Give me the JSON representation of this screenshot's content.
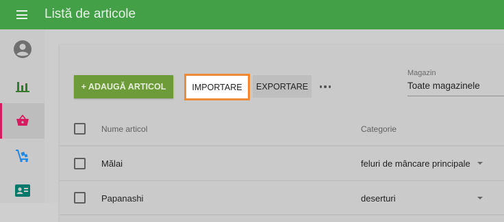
{
  "header": {
    "title": "Listă de articole",
    "bar_color": "#43a047"
  },
  "sidebar": {
    "items": [
      {
        "icon": "account-circle-icon",
        "active": false
      },
      {
        "icon": "bar-chart-icon",
        "active": false
      },
      {
        "icon": "basket-icon",
        "active": true
      },
      {
        "icon": "inventory-cart-icon",
        "active": false
      },
      {
        "icon": "contact-card-icon",
        "active": false
      }
    ],
    "active_indicator_color": "#d81b60"
  },
  "toolbar": {
    "add_label": "+ ADAUGĂ ARTICOL",
    "import_label": "IMPORTARE",
    "export_label": "EXPORTARE",
    "more_icon": "more-horizontal-icon"
  },
  "store_filter": {
    "label": "Magazin",
    "value": "Toate magazinele"
  },
  "table": {
    "headers": {
      "name": "Nume articol",
      "category": "Categorie"
    },
    "rows": [
      {
        "name": "Mălai",
        "category": "feluri de mâncare principale"
      },
      {
        "name": "Papanashi",
        "category": "deserturi"
      }
    ]
  }
}
